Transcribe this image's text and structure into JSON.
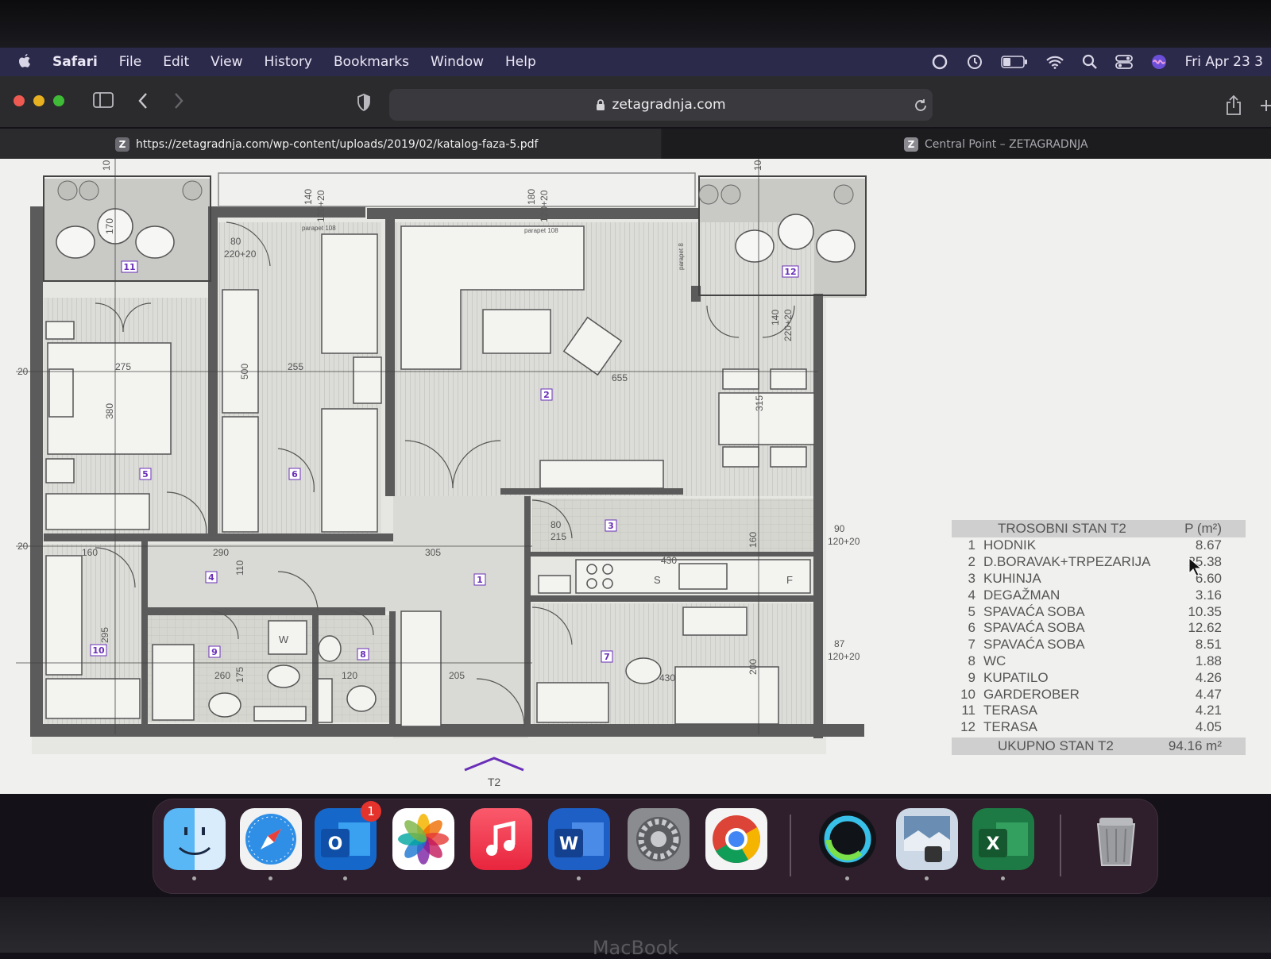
{
  "menubar": {
    "app": "Safari",
    "items": [
      "File",
      "Edit",
      "View",
      "History",
      "Bookmarks",
      "Window",
      "Help"
    ],
    "clock": "Fri Apr 23 3"
  },
  "toolbar": {
    "url": "zetagradnja.com"
  },
  "tabs": [
    {
      "favicon": "Z",
      "label": "https://zetagradnja.com/wp-content/uploads/2019/02/katalog-faza-5.pdf"
    },
    {
      "favicon": "Z",
      "label": "Central Point – ZETAGRADNJA"
    }
  ],
  "plan": {
    "rooms": [
      "1",
      "2",
      "3",
      "4",
      "5",
      "6",
      "7",
      "8",
      "9",
      "10",
      "11",
      "12"
    ],
    "dims": [
      "10",
      "140",
      "120+20",
      "180",
      "120+20",
      "10",
      "170",
      "80",
      "220+20",
      "20",
      "275",
      "380",
      "255",
      "500",
      "655",
      "315",
      "20",
      "160",
      "290",
      "305",
      "430",
      "110",
      "160",
      "295",
      "260",
      "175",
      "120",
      "205",
      "430",
      "200",
      "80",
      "215",
      "90",
      "120+20",
      "87",
      "120+20",
      "140",
      "220+20",
      "W",
      "S",
      "F",
      "T2",
      "parapet 108",
      "parapet 108",
      "parapet 8"
    ]
  },
  "legend": {
    "title": "TROSOBNI STAN T2",
    "unit": "P (m²)",
    "rows": [
      {
        "n": "1",
        "name": "HODNIK",
        "value": "8.67"
      },
      {
        "n": "2",
        "name": "D.BORAVAK+TRPEZARIJA",
        "value": "25.38"
      },
      {
        "n": "3",
        "name": "KUHINJA",
        "value": "6.60"
      },
      {
        "n": "4",
        "name": "DEGAŽMAN",
        "value": "3.16"
      },
      {
        "n": "5",
        "name": "SPAVAĆA SOBA",
        "value": "10.35"
      },
      {
        "n": "6",
        "name": "SPAVAĆA SOBA",
        "value": "12.62"
      },
      {
        "n": "7",
        "name": "SPAVAĆA SOBA",
        "value": "8.51"
      },
      {
        "n": "8",
        "name": "WC",
        "value": "1.88"
      },
      {
        "n": "9",
        "name": "KUPATILO",
        "value": "4.26"
      },
      {
        "n": "10",
        "name": "GARDEROBER",
        "value": "4.47"
      },
      {
        "n": "11",
        "name": "TERASA",
        "value": "4.21"
      },
      {
        "n": "12",
        "name": "TERASA",
        "value": "4.05"
      }
    ],
    "total_label": "UKUPNO STAN T2",
    "total_value": "94.16 m²"
  },
  "dock": {
    "apps": [
      "finder-icon",
      "safari-icon",
      "outlook-icon",
      "photos-icon",
      "music-icon",
      "word-icon",
      "system-preferences-icon",
      "chrome-icon",
      "webex-icon",
      "preview-icon",
      "excel-icon",
      "trash-icon"
    ],
    "outlook_badge": "1"
  },
  "device_label": "MacBook",
  "colors": {
    "menubar": "#2c2a4a",
    "accent": "#6a2fb8",
    "wall": "#555555"
  }
}
